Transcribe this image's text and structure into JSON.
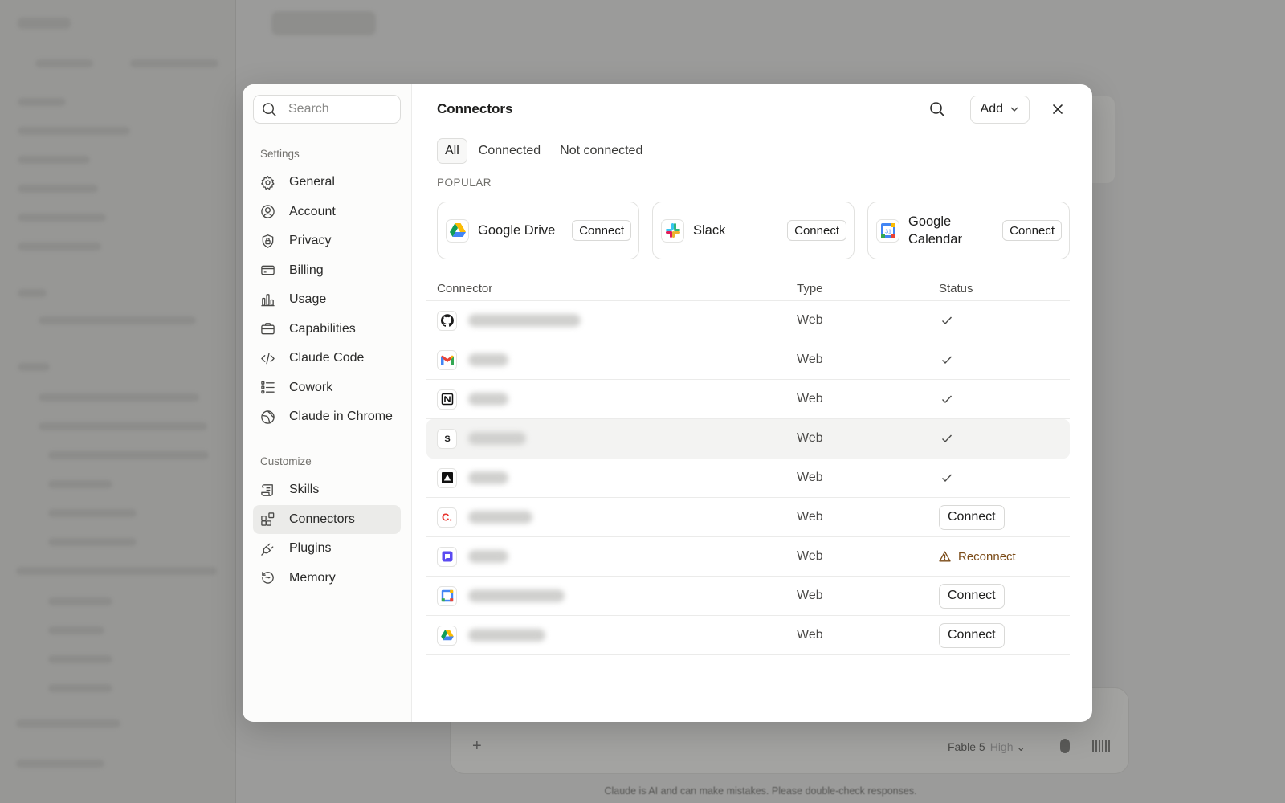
{
  "modal": {
    "search_placeholder": "Search",
    "sidebar": {
      "settings_label": "Settings",
      "settings_items": [
        {
          "label": "General",
          "icon": "gear-icon"
        },
        {
          "label": "Account",
          "icon": "user-circle-icon"
        },
        {
          "label": "Privacy",
          "icon": "shield-lock-icon"
        },
        {
          "label": "Billing",
          "icon": "credit-card-icon"
        },
        {
          "label": "Usage",
          "icon": "bar-chart-icon"
        },
        {
          "label": "Capabilities",
          "icon": "briefcase-icon"
        },
        {
          "label": "Claude Code",
          "icon": "code-icon"
        },
        {
          "label": "Cowork",
          "icon": "checklist-icon"
        },
        {
          "label": "Claude in Chrome",
          "icon": "globe-icon"
        }
      ],
      "customize_label": "Customize",
      "customize_items": [
        {
          "label": "Skills",
          "icon": "scroll-icon"
        },
        {
          "label": "Connectors",
          "icon": "blocks-icon",
          "active": true
        },
        {
          "label": "Plugins",
          "icon": "plug-icon"
        },
        {
          "label": "Memory",
          "icon": "history-icon"
        }
      ]
    },
    "header": {
      "title": "Connectors",
      "add_label": "Add"
    },
    "tabs": [
      "All",
      "Connected",
      "Not connected"
    ],
    "active_tab": "All",
    "popular_label": "POPULAR",
    "popular": [
      {
        "name": "Google Drive",
        "action": "Connect",
        "icon": "google-drive-icon"
      },
      {
        "name": "Slack",
        "action": "Connect",
        "icon": "slack-icon"
      },
      {
        "name": "Google Calendar",
        "action": "Connect",
        "icon": "google-calendar-icon"
      }
    ],
    "table": {
      "columns": [
        "Connector",
        "Type",
        "Status"
      ],
      "rows": [
        {
          "icon": "github-icon",
          "type": "Web",
          "status": "connected"
        },
        {
          "icon": "gmail-icon",
          "type": "Web",
          "status": "connected"
        },
        {
          "icon": "notion-icon",
          "type": "Web",
          "status": "connected"
        },
        {
          "icon": "s-letter-icon",
          "type": "Web",
          "status": "connected"
        },
        {
          "icon": "triangle-logo-icon",
          "type": "Web",
          "status": "connected"
        },
        {
          "icon": "c-letter-icon",
          "type": "Web",
          "status": "connect",
          "status_label": "Connect"
        },
        {
          "icon": "chat-bubble-icon",
          "type": "Web",
          "status": "reconnect",
          "status_label": "Reconnect"
        },
        {
          "icon": "google-calendar-icon",
          "type": "Web",
          "status": "connect",
          "status_label": "Connect"
        },
        {
          "icon": "google-drive-icon",
          "type": "Web",
          "status": "connect",
          "status_label": "Connect"
        }
      ]
    }
  },
  "background": {
    "model_name": "Fable 5",
    "model_effort": "High",
    "disclaimer": "Claude is AI and can make mistakes. Please double-check responses."
  }
}
